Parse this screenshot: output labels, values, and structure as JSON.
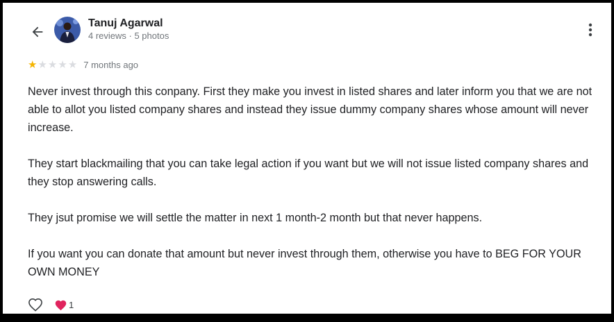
{
  "reviewer": {
    "name": "Tanuj Agarwal",
    "meta": "4 reviews · 5 photos"
  },
  "review": {
    "rating": 1,
    "max_rating": 5,
    "date": "7 months ago",
    "paragraphs": [
      "Never invest through this conpany. First they make you invest in listed shares and later inform you that we are not able to allot you listed company shares and instead they issue dummy company shares whose amount will never increase.",
      "They start blackmailing that you can take legal action if you want but we will not issue listed company shares and they stop answering calls.",
      "They jsut promise we will settle the matter in next 1 month-2 month but that never happens.",
      "If you want you can donate that amount but never invest through them, otherwise you have to BEG FOR YOUR OWN MONEY"
    ]
  },
  "reactions": {
    "count": "1"
  },
  "icons": {
    "back": "arrow-left-icon",
    "menu": "more-vertical-icon",
    "like": "heart-outline-icon",
    "reaction": "red-heart-icon"
  },
  "colors": {
    "star_on": "#f4b400",
    "star_off": "#dadce0",
    "heart": "#e0245e"
  }
}
